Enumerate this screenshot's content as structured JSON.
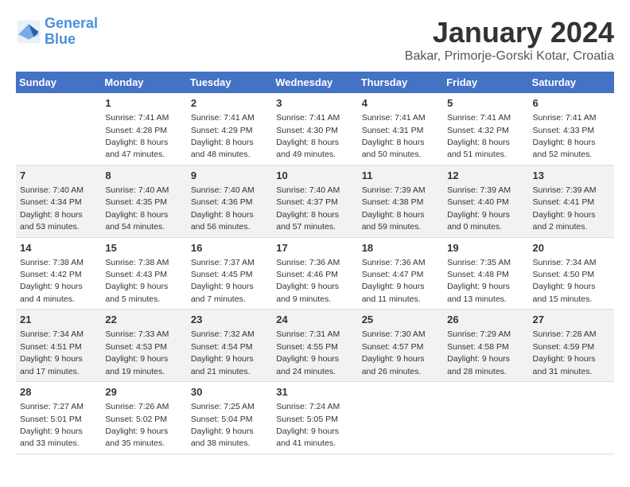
{
  "header": {
    "logo_text_general": "General",
    "logo_text_blue": "Blue",
    "month": "January 2024",
    "location": "Bakar, Primorje-Gorski Kotar, Croatia"
  },
  "weekdays": [
    "Sunday",
    "Monday",
    "Tuesday",
    "Wednesday",
    "Thursday",
    "Friday",
    "Saturday"
  ],
  "weeks": [
    [
      {
        "day": "",
        "sunrise": "",
        "sunset": "",
        "daylight": ""
      },
      {
        "day": "1",
        "sunrise": "Sunrise: 7:41 AM",
        "sunset": "Sunset: 4:28 PM",
        "daylight": "Daylight: 8 hours and 47 minutes."
      },
      {
        "day": "2",
        "sunrise": "Sunrise: 7:41 AM",
        "sunset": "Sunset: 4:29 PM",
        "daylight": "Daylight: 8 hours and 48 minutes."
      },
      {
        "day": "3",
        "sunrise": "Sunrise: 7:41 AM",
        "sunset": "Sunset: 4:30 PM",
        "daylight": "Daylight: 8 hours and 49 minutes."
      },
      {
        "day": "4",
        "sunrise": "Sunrise: 7:41 AM",
        "sunset": "Sunset: 4:31 PM",
        "daylight": "Daylight: 8 hours and 50 minutes."
      },
      {
        "day": "5",
        "sunrise": "Sunrise: 7:41 AM",
        "sunset": "Sunset: 4:32 PM",
        "daylight": "Daylight: 8 hours and 51 minutes."
      },
      {
        "day": "6",
        "sunrise": "Sunrise: 7:41 AM",
        "sunset": "Sunset: 4:33 PM",
        "daylight": "Daylight: 8 hours and 52 minutes."
      }
    ],
    [
      {
        "day": "7",
        "sunrise": "Sunrise: 7:40 AM",
        "sunset": "Sunset: 4:34 PM",
        "daylight": "Daylight: 8 hours and 53 minutes."
      },
      {
        "day": "8",
        "sunrise": "Sunrise: 7:40 AM",
        "sunset": "Sunset: 4:35 PM",
        "daylight": "Daylight: 8 hours and 54 minutes."
      },
      {
        "day": "9",
        "sunrise": "Sunrise: 7:40 AM",
        "sunset": "Sunset: 4:36 PM",
        "daylight": "Daylight: 8 hours and 56 minutes."
      },
      {
        "day": "10",
        "sunrise": "Sunrise: 7:40 AM",
        "sunset": "Sunset: 4:37 PM",
        "daylight": "Daylight: 8 hours and 57 minutes."
      },
      {
        "day": "11",
        "sunrise": "Sunrise: 7:39 AM",
        "sunset": "Sunset: 4:38 PM",
        "daylight": "Daylight: 8 hours and 59 minutes."
      },
      {
        "day": "12",
        "sunrise": "Sunrise: 7:39 AM",
        "sunset": "Sunset: 4:40 PM",
        "daylight": "Daylight: 9 hours and 0 minutes."
      },
      {
        "day": "13",
        "sunrise": "Sunrise: 7:39 AM",
        "sunset": "Sunset: 4:41 PM",
        "daylight": "Daylight: 9 hours and 2 minutes."
      }
    ],
    [
      {
        "day": "14",
        "sunrise": "Sunrise: 7:38 AM",
        "sunset": "Sunset: 4:42 PM",
        "daylight": "Daylight: 9 hours and 4 minutes."
      },
      {
        "day": "15",
        "sunrise": "Sunrise: 7:38 AM",
        "sunset": "Sunset: 4:43 PM",
        "daylight": "Daylight: 9 hours and 5 minutes."
      },
      {
        "day": "16",
        "sunrise": "Sunrise: 7:37 AM",
        "sunset": "Sunset: 4:45 PM",
        "daylight": "Daylight: 9 hours and 7 minutes."
      },
      {
        "day": "17",
        "sunrise": "Sunrise: 7:36 AM",
        "sunset": "Sunset: 4:46 PM",
        "daylight": "Daylight: 9 hours and 9 minutes."
      },
      {
        "day": "18",
        "sunrise": "Sunrise: 7:36 AM",
        "sunset": "Sunset: 4:47 PM",
        "daylight": "Daylight: 9 hours and 11 minutes."
      },
      {
        "day": "19",
        "sunrise": "Sunrise: 7:35 AM",
        "sunset": "Sunset: 4:48 PM",
        "daylight": "Daylight: 9 hours and 13 minutes."
      },
      {
        "day": "20",
        "sunrise": "Sunrise: 7:34 AM",
        "sunset": "Sunset: 4:50 PM",
        "daylight": "Daylight: 9 hours and 15 minutes."
      }
    ],
    [
      {
        "day": "21",
        "sunrise": "Sunrise: 7:34 AM",
        "sunset": "Sunset: 4:51 PM",
        "daylight": "Daylight: 9 hours and 17 minutes."
      },
      {
        "day": "22",
        "sunrise": "Sunrise: 7:33 AM",
        "sunset": "Sunset: 4:53 PM",
        "daylight": "Daylight: 9 hours and 19 minutes."
      },
      {
        "day": "23",
        "sunrise": "Sunrise: 7:32 AM",
        "sunset": "Sunset: 4:54 PM",
        "daylight": "Daylight: 9 hours and 21 minutes."
      },
      {
        "day": "24",
        "sunrise": "Sunrise: 7:31 AM",
        "sunset": "Sunset: 4:55 PM",
        "daylight": "Daylight: 9 hours and 24 minutes."
      },
      {
        "day": "25",
        "sunrise": "Sunrise: 7:30 AM",
        "sunset": "Sunset: 4:57 PM",
        "daylight": "Daylight: 9 hours and 26 minutes."
      },
      {
        "day": "26",
        "sunrise": "Sunrise: 7:29 AM",
        "sunset": "Sunset: 4:58 PM",
        "daylight": "Daylight: 9 hours and 28 minutes."
      },
      {
        "day": "27",
        "sunrise": "Sunrise: 7:28 AM",
        "sunset": "Sunset: 4:59 PM",
        "daylight": "Daylight: 9 hours and 31 minutes."
      }
    ],
    [
      {
        "day": "28",
        "sunrise": "Sunrise: 7:27 AM",
        "sunset": "Sunset: 5:01 PM",
        "daylight": "Daylight: 9 hours and 33 minutes."
      },
      {
        "day": "29",
        "sunrise": "Sunrise: 7:26 AM",
        "sunset": "Sunset: 5:02 PM",
        "daylight": "Daylight: 9 hours and 35 minutes."
      },
      {
        "day": "30",
        "sunrise": "Sunrise: 7:25 AM",
        "sunset": "Sunset: 5:04 PM",
        "daylight": "Daylight: 9 hours and 38 minutes."
      },
      {
        "day": "31",
        "sunrise": "Sunrise: 7:24 AM",
        "sunset": "Sunset: 5:05 PM",
        "daylight": "Daylight: 9 hours and 41 minutes."
      },
      {
        "day": "",
        "sunrise": "",
        "sunset": "",
        "daylight": ""
      },
      {
        "day": "",
        "sunrise": "",
        "sunset": "",
        "daylight": ""
      },
      {
        "day": "",
        "sunrise": "",
        "sunset": "",
        "daylight": ""
      }
    ]
  ]
}
